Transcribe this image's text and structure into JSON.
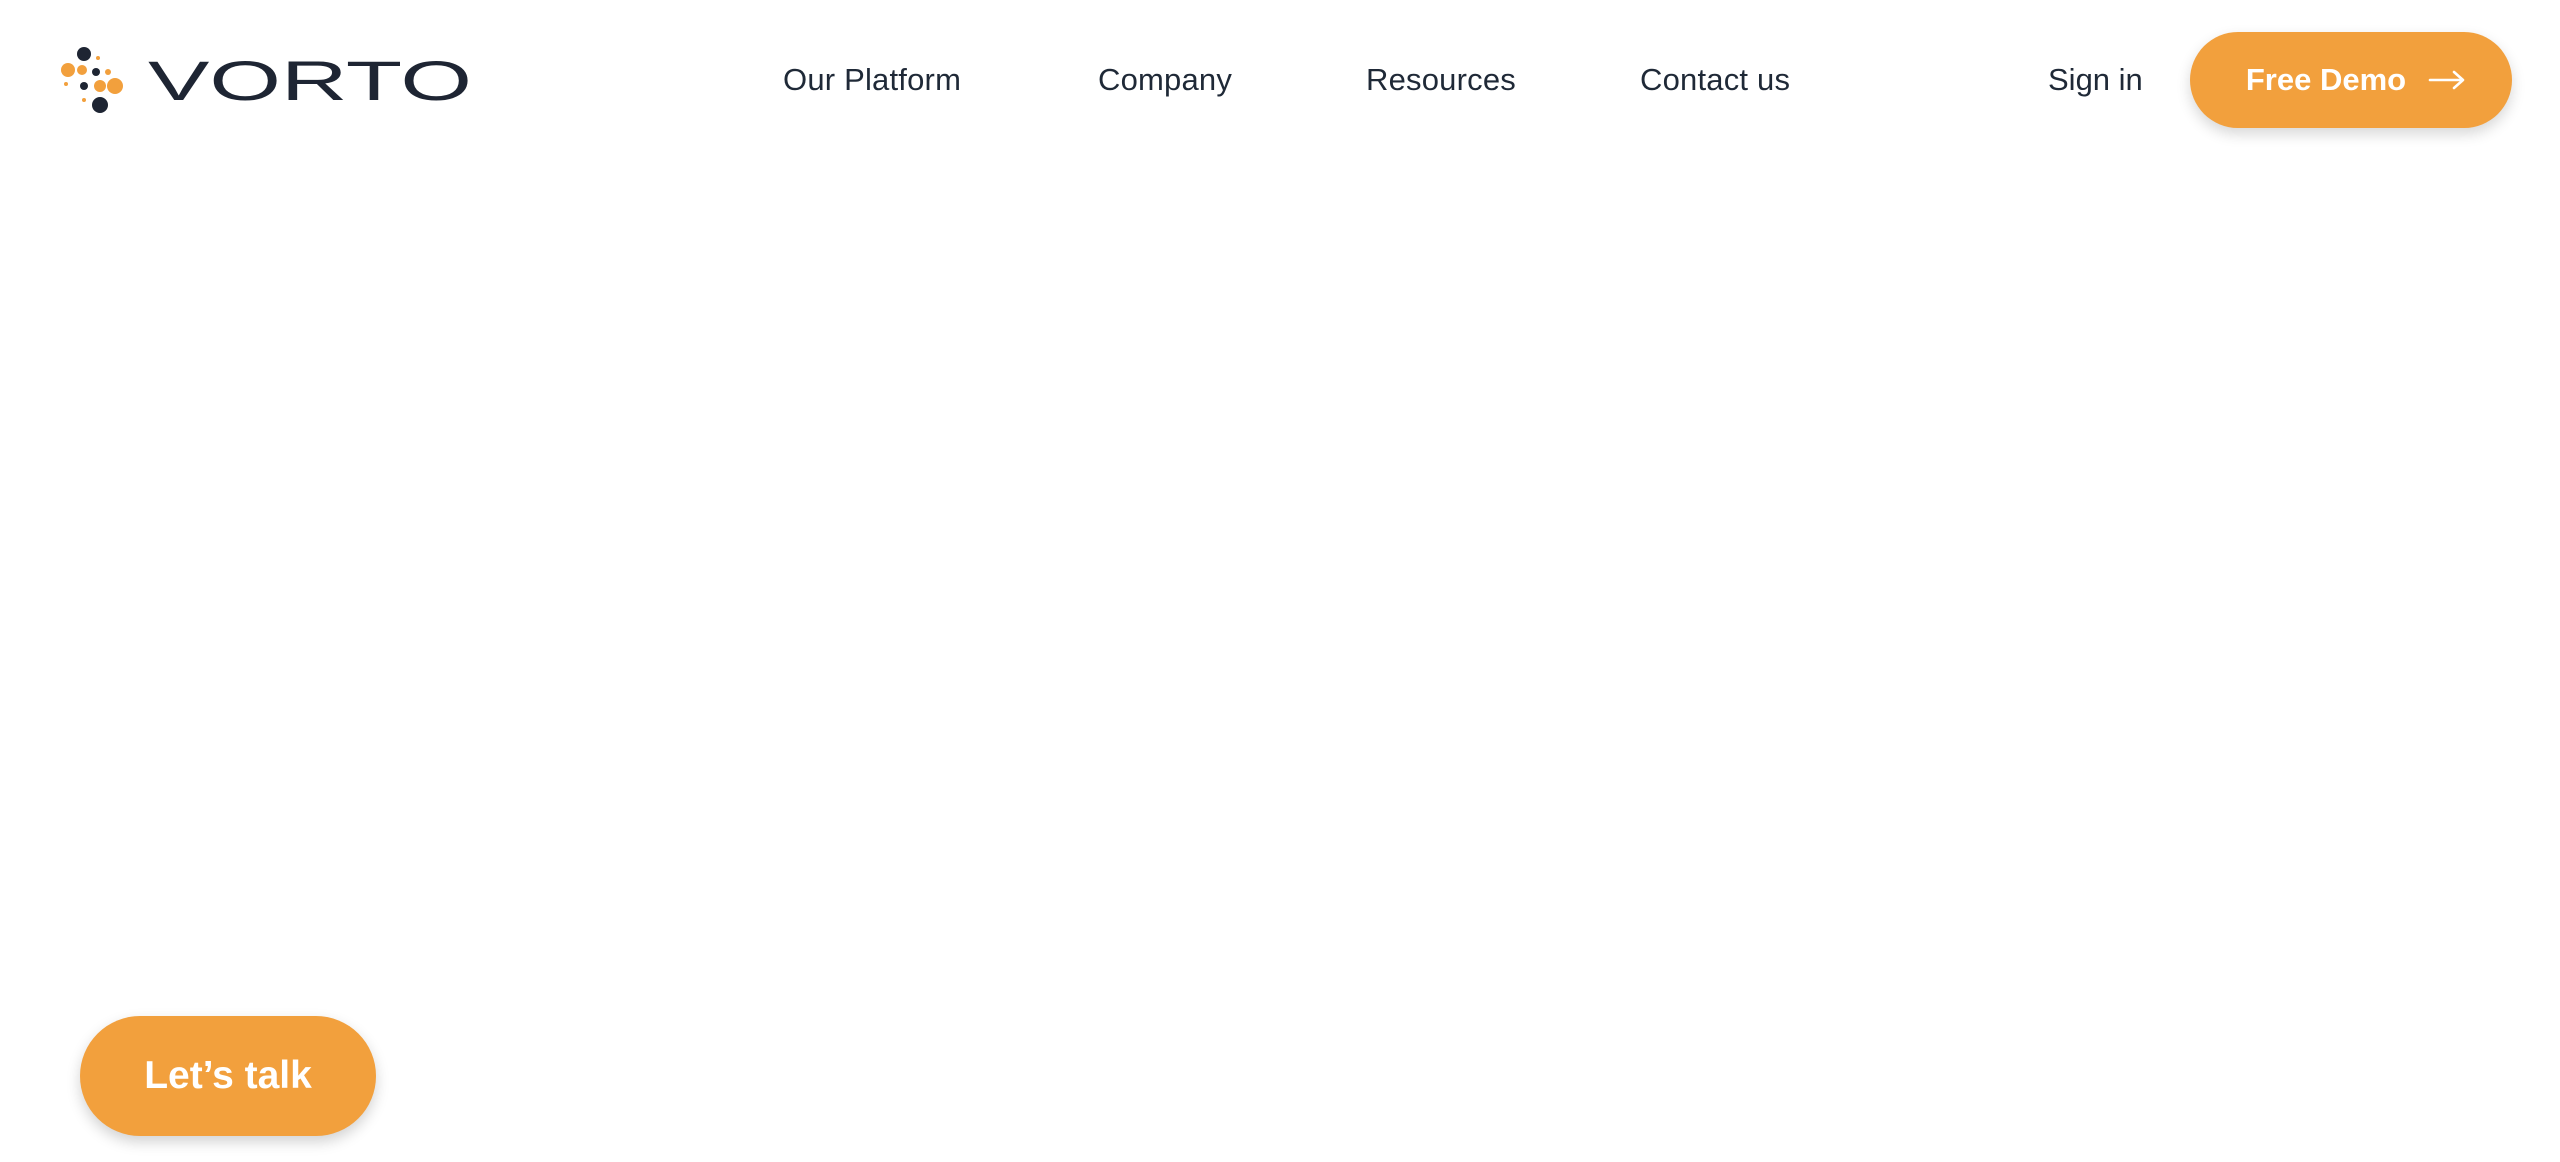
{
  "header": {
    "logo_text": "VORTO",
    "nav": [
      {
        "label": "Our Platform"
      },
      {
        "label": "Company"
      },
      {
        "label": "Resources"
      },
      {
        "label": "Contact us"
      }
    ],
    "sign_in_label": "Sign in",
    "demo_button_label": "Free Demo",
    "demo_button_icon": "arrow-right-icon"
  },
  "chat": {
    "button_label": "Let’s talk"
  },
  "colors": {
    "brand_orange": "#f2a03d",
    "text_dark": "#1f2937",
    "logo_dark": "#1e2533",
    "background": "#ffffff"
  }
}
